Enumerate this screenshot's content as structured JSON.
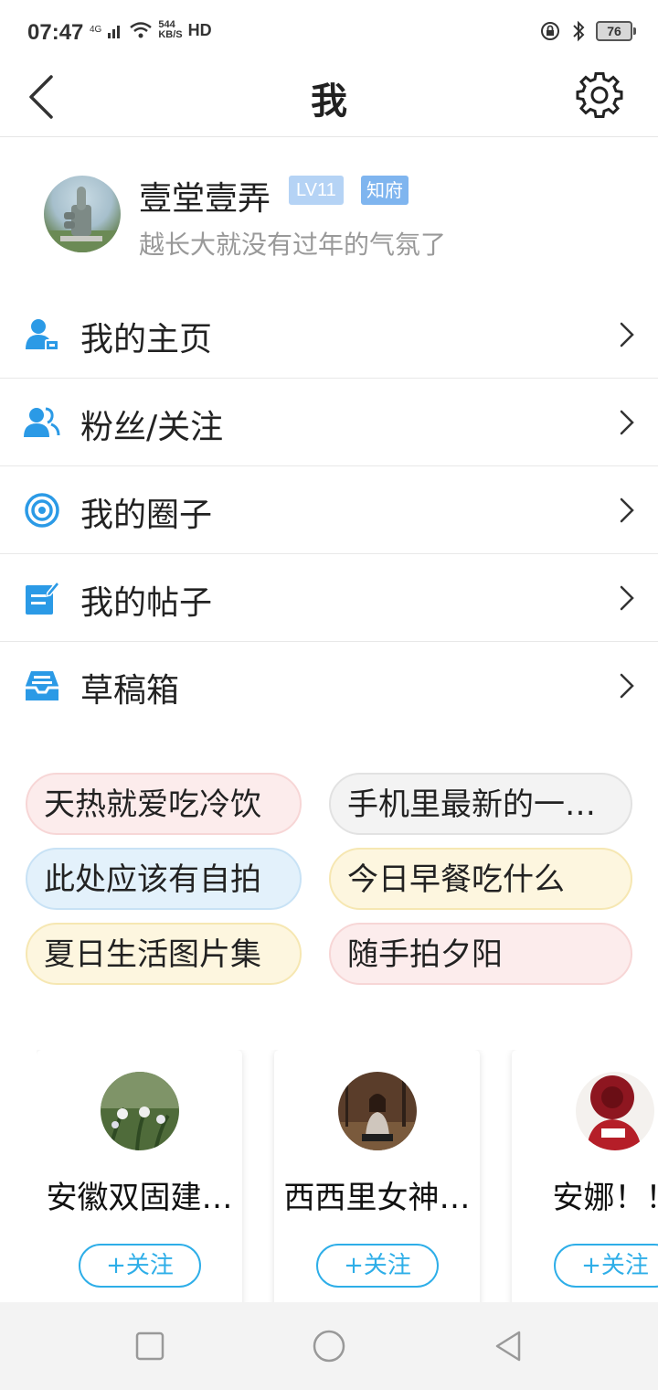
{
  "status_bar": {
    "time": "07:47",
    "network": "4G",
    "speed_value": "544",
    "speed_unit": "KB/S",
    "hd": "HD",
    "battery": "76"
  },
  "header": {
    "title": "我",
    "back_icon": "back-arrow-icon",
    "settings_icon": "gear-icon"
  },
  "profile": {
    "username": "壹堂壹弄",
    "level": "LV11",
    "rank": "知府",
    "signature": "越长大就没有过年的气氛了"
  },
  "menu": {
    "items": [
      {
        "label": "我的主页",
        "icon": "person-card-icon"
      },
      {
        "label": "粉丝/关注",
        "icon": "people-icon"
      },
      {
        "label": "我的圈子",
        "icon": "target-circle-icon"
      },
      {
        "label": "我的帖子",
        "icon": "edit-note-icon"
      },
      {
        "label": "草稿箱",
        "icon": "inbox-tray-icon"
      }
    ]
  },
  "tags": [
    {
      "label": "天热就爱吃冷饮",
      "bg": "#fcecec",
      "border": "#f7d6d6"
    },
    {
      "label": "手机里最新的一…",
      "bg": "#f3f3f3",
      "border": "#e2e2e2"
    },
    {
      "label": "此处应该有自拍",
      "bg": "#e3f1fb",
      "border": "#c8e2f5"
    },
    {
      "label": "今日早餐吃什么",
      "bg": "#fdf6df",
      "border": "#f6e7b2"
    },
    {
      "label": "夏日生活图片集",
      "bg": "#fdf6df",
      "border": "#f6e7b2"
    },
    {
      "label": "随手拍夕阳",
      "bg": "#fcecec",
      "border": "#f7d6d6"
    }
  ],
  "recommend": [
    {
      "name": "安徽双固建…",
      "follow_label": "+关注"
    },
    {
      "name": "西西里女神…",
      "follow_label": "+关注"
    },
    {
      "name": "安娜！！",
      "follow_label": "+关注"
    }
  ],
  "colors": {
    "accent": "#2eaee8",
    "icon_blue": "#2b9ae6"
  }
}
